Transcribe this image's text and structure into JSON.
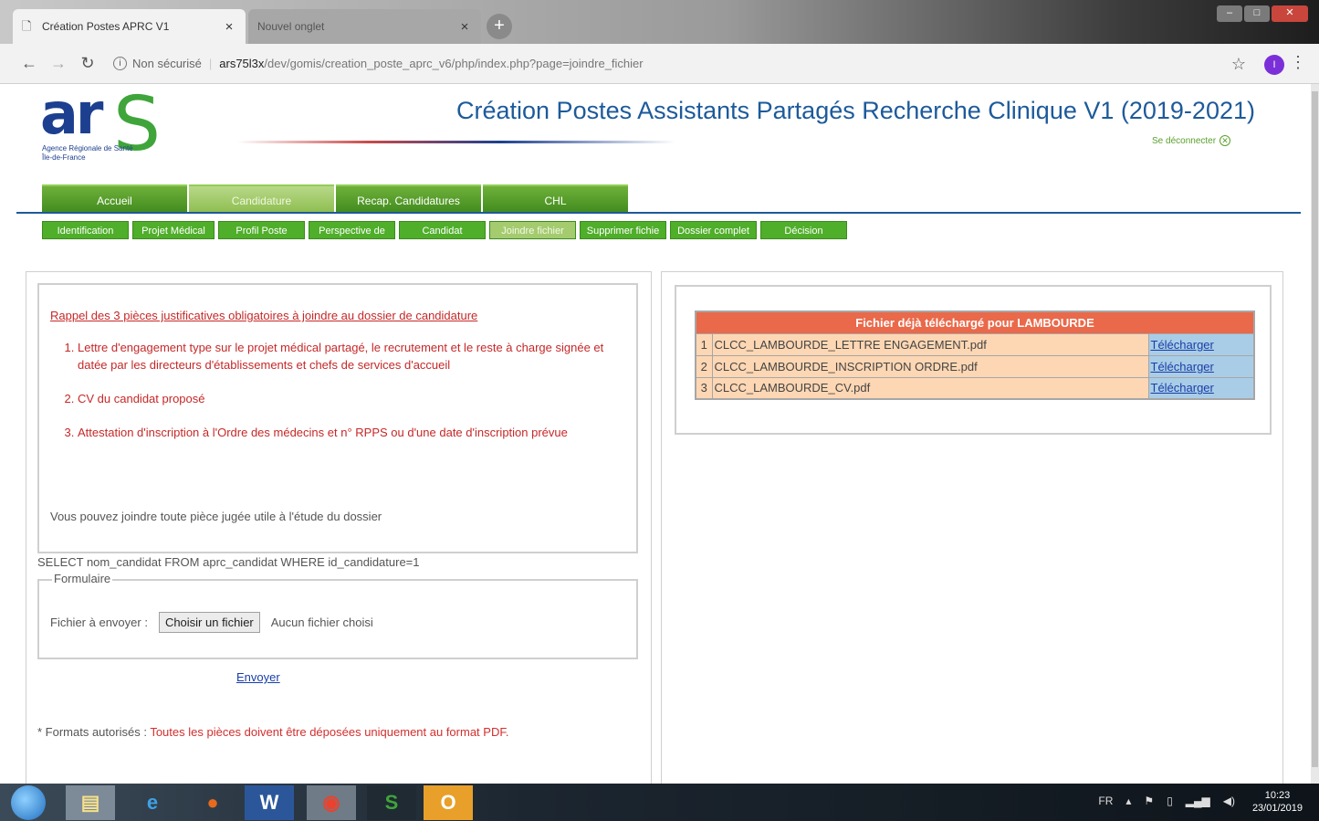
{
  "browser": {
    "tabs": [
      {
        "title": "Création Postes APRC V1",
        "close": "×"
      },
      {
        "title": "Nouvel onglet",
        "close": "×"
      }
    ],
    "new_tab": "+",
    "url_security": "Non sécurisé",
    "url_host": "ars75l3x",
    "url_path": "/dev/gomis/creation_poste_aprc_v6/php/index.php?page=joindre_fichier",
    "profile_initial": "I"
  },
  "header": {
    "logo_text_ar": "ar",
    "logo_text_s": "S",
    "logo_subtitle": "Agence Régionale de Santé Île-de-France",
    "title": "Création Postes Assistants Partagés Recherche Clinique V1 (2019-2021)",
    "logout": "Se déconnecter"
  },
  "main_nav": [
    {
      "label": "Accueil",
      "active": false
    },
    {
      "label": "Candidature",
      "active": true
    },
    {
      "label": "Recap. Candidatures",
      "active": false
    },
    {
      "label": "CHL",
      "active": false
    }
  ],
  "sub_nav": [
    {
      "label": "Identification",
      "active": false
    },
    {
      "label": "Projet Médical",
      "active": false
    },
    {
      "label": "Profil Poste",
      "active": false
    },
    {
      "label": "Perspective de",
      "active": false
    },
    {
      "label": "Candidat",
      "active": false
    },
    {
      "label": "Joindre fichier",
      "active": true
    },
    {
      "label": "Supprimer fichie",
      "active": false
    },
    {
      "label": "Dossier complet",
      "active": false
    },
    {
      "label": "Décision",
      "active": false
    }
  ],
  "rappel": {
    "title": "Rappel des 3 pièces justificatives obligatoires à joindre au dossier de candidature",
    "items": [
      "Lettre d'engagement type sur le projet médical partagé, le recrutement et le reste à charge signée et datée par les directeurs d'établissements et chefs de services d'accueil",
      "CV du candidat proposé",
      "Attestation d'inscription à l'Ordre des médecins et n° RPPS ou d'une date d'inscription prévue"
    ],
    "hint": "Vous pouvez joindre toute pièce jugée utile à l'étude du dossier"
  },
  "sql_debug": "SELECT nom_candidat FROM aprc_candidat WHERE id_candidature=1",
  "form": {
    "legend": "Formulaire",
    "file_label": "Fichier à envoyer :",
    "choose_button": "Choisir un fichier",
    "no_file": "Aucun fichier choisi",
    "submit": "Envoyer"
  },
  "formats": {
    "label": "* Formats autorisés :",
    "warning": "Toutes les pièces doivent être déposées uniquement au format PDF."
  },
  "files_table": {
    "header": "Fichier déjà téléchargé pour LAMBOURDE",
    "rows": [
      {
        "num": "1",
        "name": "CLCC_LAMBOURDE_LETTRE ENGAGEMENT.pdf",
        "action": "Télécharger"
      },
      {
        "num": "2",
        "name": "CLCC_LAMBOURDE_INSCRIPTION ORDRE.pdf",
        "action": "Télécharger"
      },
      {
        "num": "3",
        "name": "CLCC_LAMBOURDE_CV.pdf",
        "action": "Télécharger"
      }
    ]
  },
  "taskbar": {
    "language": "FR",
    "time": "10:23",
    "date": "23/01/2019"
  },
  "colors": {
    "nav_green": "#4fae2a",
    "title_blue": "#1d5a9a",
    "warning_red": "#c62828",
    "table_header": "#e9694a",
    "table_row": "#fdd7b4",
    "action_cell": "#a9cde6"
  }
}
